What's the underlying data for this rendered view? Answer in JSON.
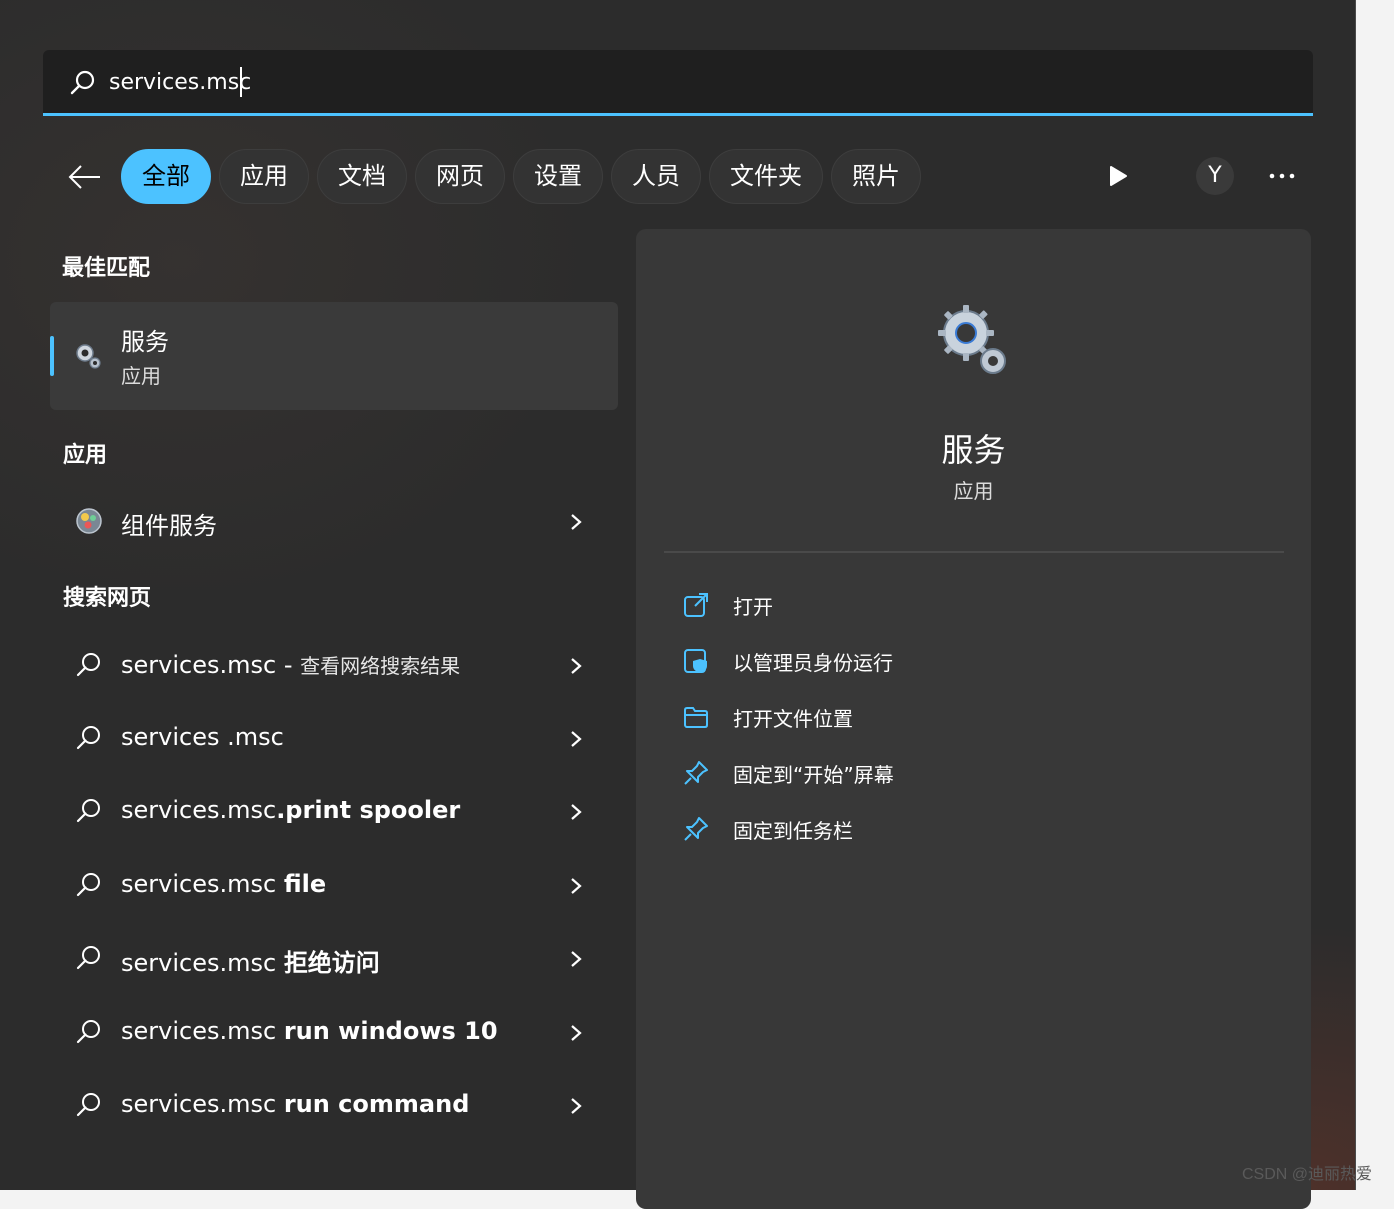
{
  "search": {
    "query": "services.msc",
    "placeholder": ""
  },
  "tabs": [
    {
      "label": "全部",
      "active": true
    },
    {
      "label": "应用"
    },
    {
      "label": "文档"
    },
    {
      "label": "网页"
    },
    {
      "label": "设置"
    },
    {
      "label": "人员"
    },
    {
      "label": "文件夹"
    },
    {
      "label": "照片"
    }
  ],
  "avatar_initial": "Y",
  "left": {
    "best_match_heading": "最佳匹配",
    "best_match": {
      "title": "服务",
      "type": "应用"
    },
    "apps_heading": "应用",
    "apps": [
      {
        "label": "组件服务"
      }
    ],
    "web_heading": "搜索网页",
    "web_results": [
      {
        "prefix": "services.msc",
        "bold": "",
        "suffix": " - ",
        "sub": "查看网络搜索结果"
      },
      {
        "prefix": "services .msc",
        "bold": "",
        "suffix": "",
        "sub": ""
      },
      {
        "prefix": "services.msc",
        "bold": ".print spooler",
        "suffix": "",
        "sub": ""
      },
      {
        "prefix": "services.msc ",
        "bold": "file",
        "suffix": "",
        "sub": ""
      },
      {
        "prefix": "services.msc ",
        "bold": "拒绝访问",
        "suffix": "",
        "sub": ""
      },
      {
        "prefix": "services.msc ",
        "bold": "run windows 10",
        "suffix": "",
        "sub": ""
      },
      {
        "prefix": "services.msc ",
        "bold": "run command",
        "suffix": "",
        "sub": ""
      }
    ]
  },
  "right": {
    "title": "服务",
    "subtitle": "应用",
    "actions": [
      {
        "label": "打开",
        "icon": "open-external-icon"
      },
      {
        "label": "以管理员身份运行",
        "icon": "run-as-admin-icon"
      },
      {
        "label": "打开文件位置",
        "icon": "folder-icon"
      },
      {
        "label": "固定到“开始”屏幕",
        "icon": "pin-icon"
      },
      {
        "label": "固定到任务栏",
        "icon": "pin-icon"
      }
    ]
  },
  "colors": {
    "accent": "#4cc2ff",
    "background": "#2c2c2c",
    "panel": "#383838"
  },
  "watermark": "CSDN @迪丽热爱"
}
